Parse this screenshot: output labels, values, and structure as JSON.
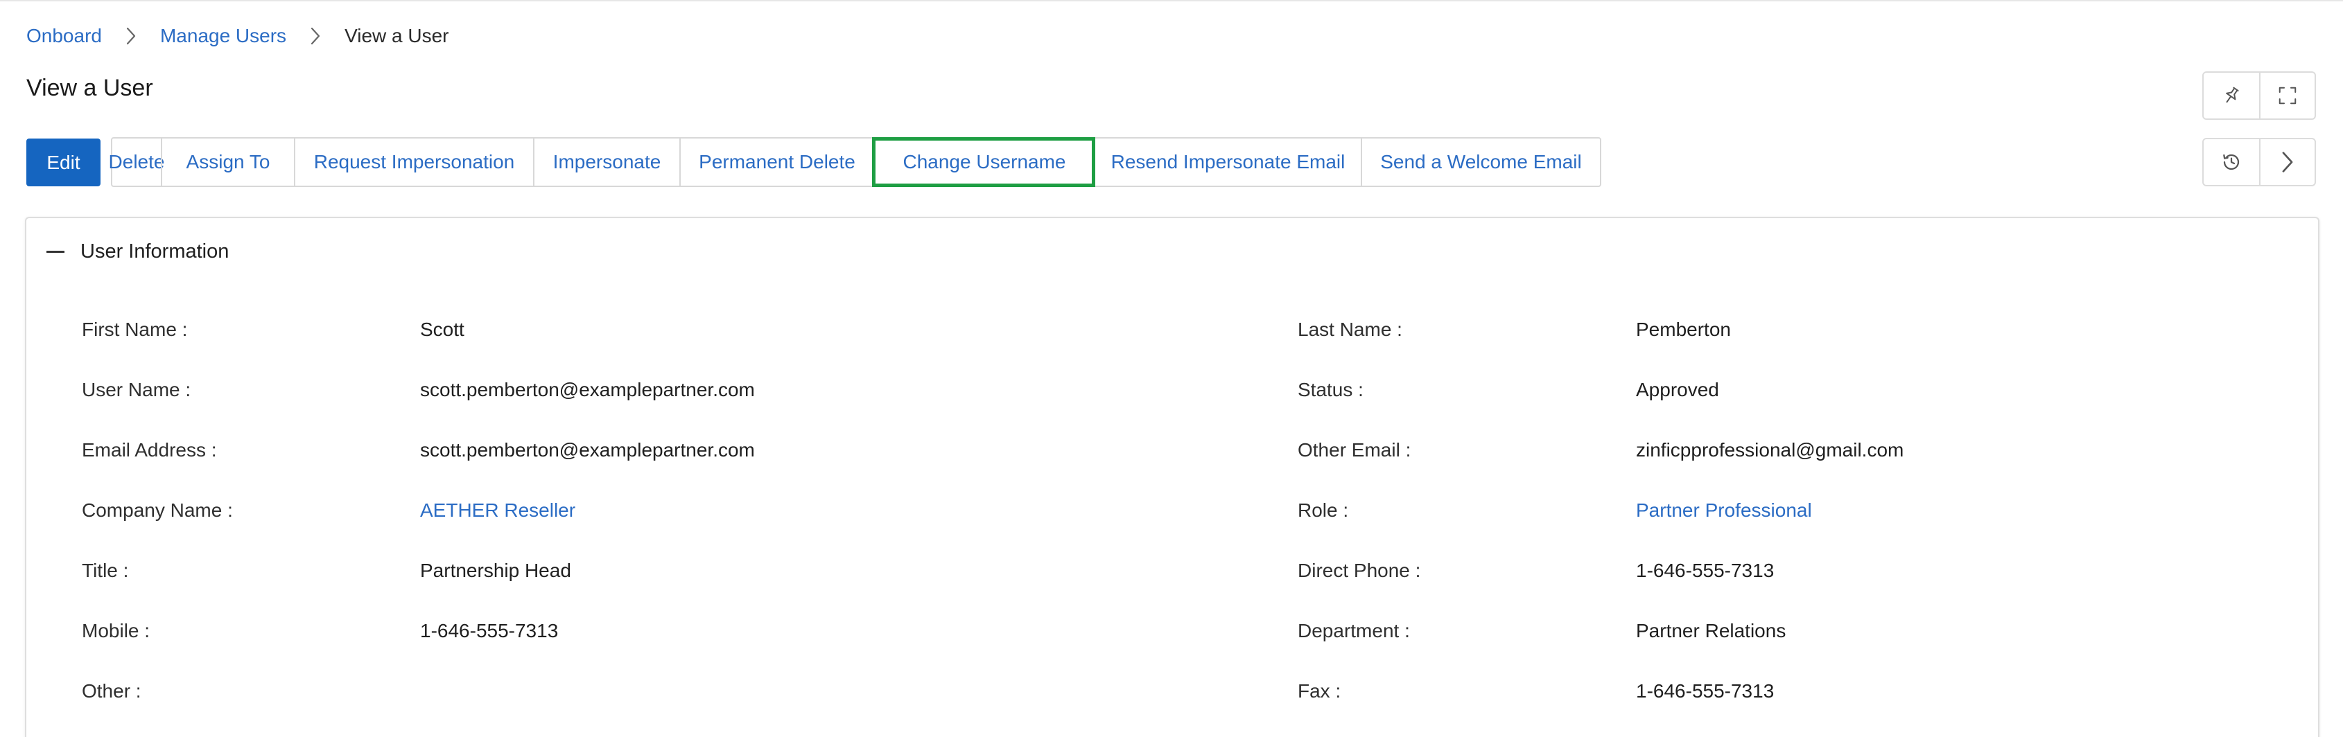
{
  "breadcrumb": {
    "items": [
      "Onboard",
      "Manage Users"
    ],
    "current": "View a User"
  },
  "page": {
    "title": "View a User"
  },
  "toolbar": {
    "edit_label": "Edit",
    "actions": [
      "Delete",
      "Assign To",
      "Request Impersonation",
      "Impersonate",
      "Permanent Delete",
      "Change Username",
      "Resend Impersonate Email",
      "Send a Welcome Email"
    ],
    "highlighted_action": "Change Username",
    "highlight_color": "#1e9e43",
    "accent_color": "#1565c0",
    "link_color": "#2b6cc4"
  },
  "icons": {
    "top_group": [
      "pin-icon",
      "fullscreen-icon"
    ],
    "mid_group": [
      "history-icon",
      "chevron-right-icon"
    ]
  },
  "user_info": {
    "section_title": "User Information",
    "left": [
      {
        "label": "First Name :",
        "value": "Scott"
      },
      {
        "label": "User Name :",
        "value": "scott.pemberton@examplepartner.com"
      },
      {
        "label": "Email Address :",
        "value": "scott.pemberton@examplepartner.com"
      },
      {
        "label": "Company Name :",
        "value": "AETHER Reseller"
      },
      {
        "label": "Title :",
        "value": "Partnership Head"
      },
      {
        "label": "Mobile :",
        "value": "1-646-555-7313"
      },
      {
        "label": "Other :",
        "value": ""
      }
    ],
    "right": [
      {
        "label": "Last Name :",
        "value": "Pemberton"
      },
      {
        "label": "Status :",
        "value": "Approved"
      },
      {
        "label": "Other Email :",
        "value": "zinficpprofessional@gmail.com"
      },
      {
        "label": "Role :",
        "value": "Partner Professional"
      },
      {
        "label": "Direct Phone :",
        "value": "1-646-555-7313"
      },
      {
        "label": "Department :",
        "value": "Partner Relations"
      },
      {
        "label": "Fax :",
        "value": "1-646-555-7313"
      }
    ]
  }
}
